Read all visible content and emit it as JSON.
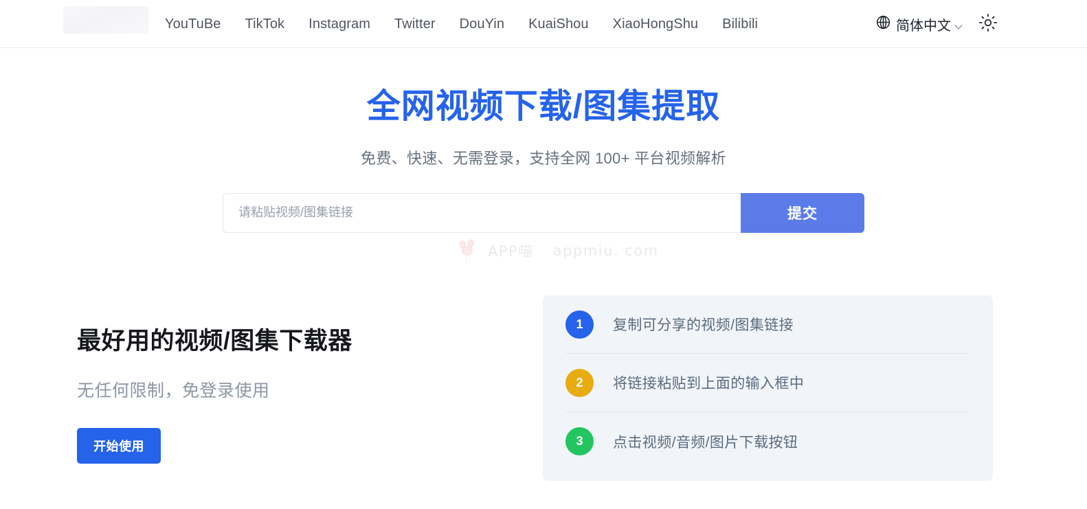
{
  "header": {
    "logo_name": "site-logo-placeholder",
    "nav": [
      {
        "label": "YouTuBe",
        "name": "nav-item-youtube"
      },
      {
        "label": "TikTok",
        "name": "nav-item-tiktok"
      },
      {
        "label": "Instagram",
        "name": "nav-item-instagram"
      },
      {
        "label": "Twitter",
        "name": "nav-item-twitter"
      },
      {
        "label": "DouYin",
        "name": "nav-item-douyin"
      },
      {
        "label": "KuaiShou",
        "name": "nav-item-kuaishou"
      },
      {
        "label": "XiaoHongShu",
        "name": "nav-item-xiaohongshu"
      },
      {
        "label": "Bilibili",
        "name": "nav-item-bilibili"
      }
    ],
    "language": {
      "icon": "globe-icon",
      "label": "简体中文",
      "chevron": "chevron-down-icon"
    },
    "theme_toggle_icon": "sun-icon"
  },
  "hero": {
    "title": "全网视频下载/图集提取",
    "subtitle": "免费、快速、无需登录，支持全网 100+ 平台视频解析"
  },
  "search": {
    "placeholder": "请粘贴视频/图集链接",
    "value": "",
    "submit_label": "提交"
  },
  "watermark": {
    "icon": "cat-paw-icon",
    "brand": "APP喵",
    "domain": "appmiu. com"
  },
  "promo": {
    "title": "最好用的视频/图集下载器",
    "subtitle": "无任何限制，免登录使用",
    "cta_label": "开始使用"
  },
  "steps": {
    "items": [
      {
        "number": "1",
        "text": "复制可分享的视频/图集链接",
        "color": "#2563eb"
      },
      {
        "number": "2",
        "text": "将链接粘贴到上面的输入框中",
        "color": "#e8ab10"
      },
      {
        "number": "3",
        "text": "点击视频/音频/图片下载按钮",
        "color": "#22c55e"
      }
    ]
  },
  "colors": {
    "primary_blue": "#2563eb",
    "submit_blue": "#5b7ce8",
    "panel_bg": "#f1f4f8",
    "step_amber": "#e8ab10",
    "step_green": "#22c55e",
    "nav_text": "#4f5560",
    "subtitle_text": "#67717f"
  }
}
